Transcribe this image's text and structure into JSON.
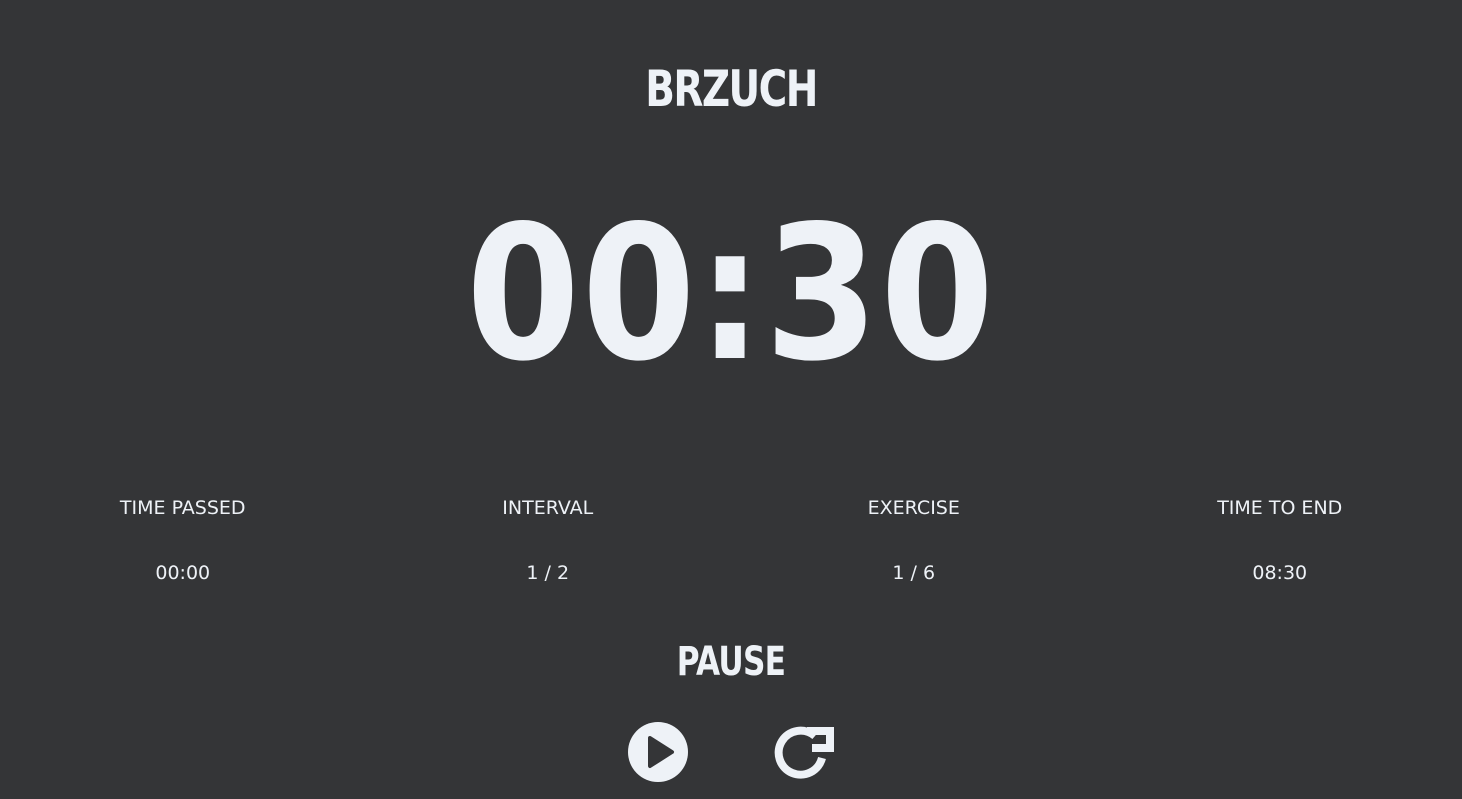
{
  "workout": {
    "title": "BRZUCH"
  },
  "timer": {
    "display": "00:30"
  },
  "stats": [
    {
      "label": "TIME PASSED",
      "value": "00:00"
    },
    {
      "label": "INTERVAL",
      "value": "1 / 2"
    },
    {
      "label": "EXERCISE",
      "value": "1 / 6"
    },
    {
      "label": "TIME TO END",
      "value": "08:30"
    }
  ],
  "status": {
    "text": "PAUSE"
  },
  "controls": {
    "play_icon": "play-icon",
    "restart_icon": "restart-icon"
  },
  "colors": {
    "background": "#343537",
    "foreground": "#eef2f7"
  }
}
